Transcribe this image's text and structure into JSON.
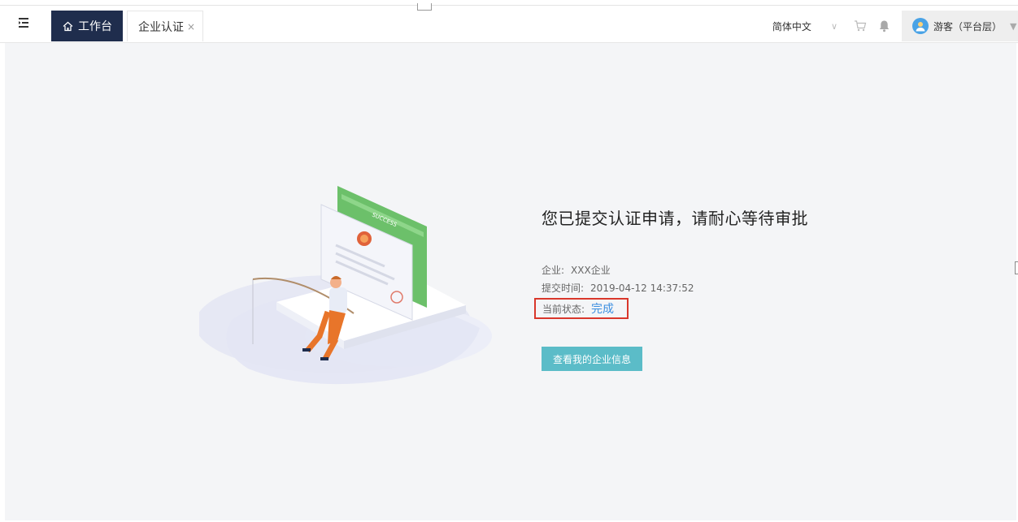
{
  "header": {
    "tabs": [
      {
        "label": "工作台",
        "icon": "home-icon",
        "active": true
      },
      {
        "label": "企业认证",
        "closable": true,
        "close_symbol": "×"
      }
    ],
    "language": "简体中文",
    "user_name": "游客（平台层）",
    "icons": [
      "menu-toggle-icon",
      "cart-icon",
      "bell-icon",
      "user-avatar-icon"
    ]
  },
  "main": {
    "title": "您已提交认证申请，请耐心等待审批",
    "enterprise_label": "企业:",
    "enterprise_value": "XXX企业",
    "submit_time_label": "提交时间:",
    "submit_time_value": "2019-04-12 14:37:52",
    "status_label": "当前状态:",
    "status_value": "完成",
    "action_button": "查看我的企业信息",
    "illustration_text": "SUCCESS"
  },
  "colors": {
    "tab_active_bg": "#1f2d4d",
    "status_highlight_border": "#d9372b",
    "status_value": "#3b8fe0",
    "action_button_bg": "#5bbcc8"
  }
}
